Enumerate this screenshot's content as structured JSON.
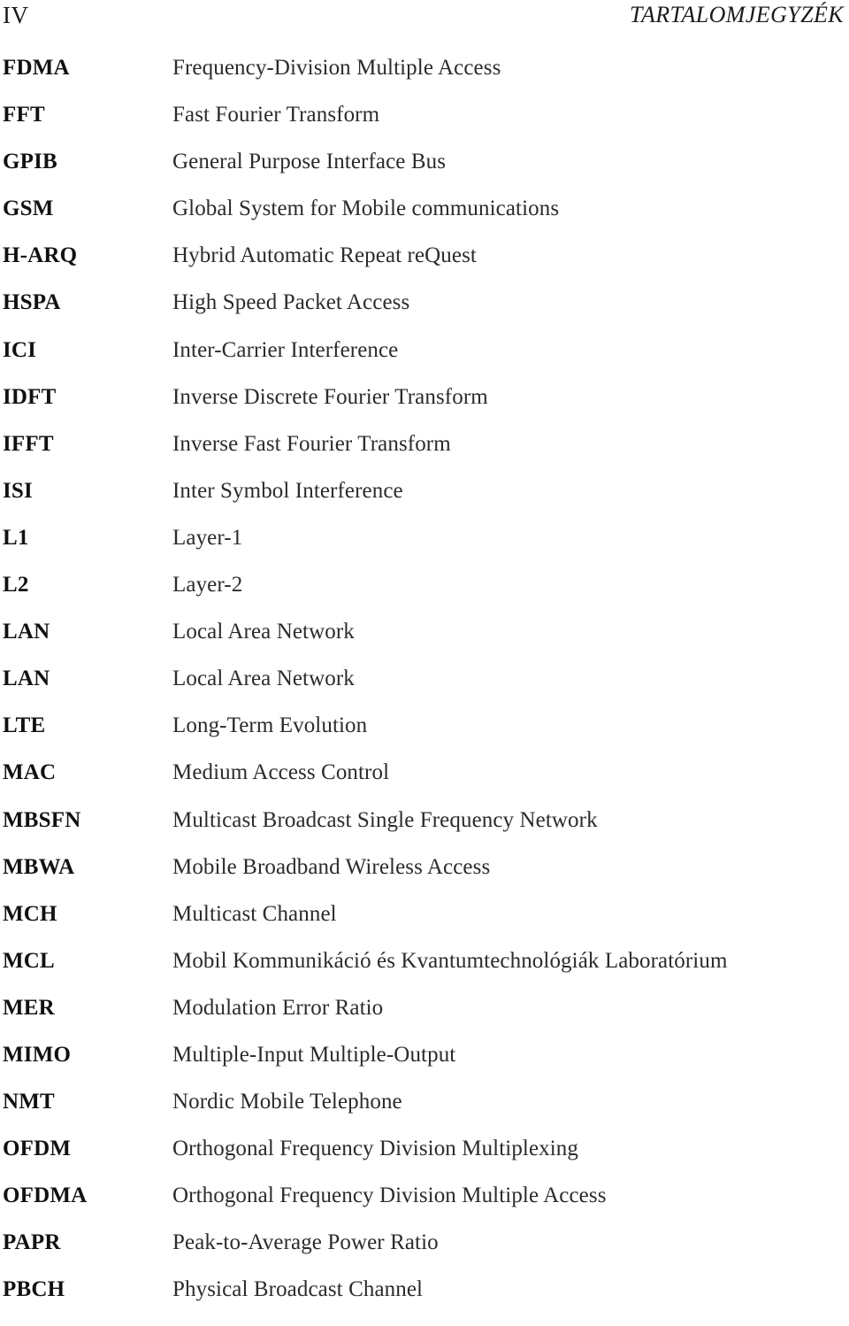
{
  "header": {
    "folio": "IV",
    "running_title": "TARTALOMJEGYZÉK"
  },
  "glossary": {
    "rows": [
      {
        "abbr": "FDMA",
        "definition": "Frequency-Division Multiple Access"
      },
      {
        "abbr": "FFT",
        "definition": "Fast Fourier Transform"
      },
      {
        "abbr": "GPIB",
        "definition": "General Purpose Interface Bus"
      },
      {
        "abbr": "GSM",
        "definition": "Global System for Mobile communications"
      },
      {
        "abbr": "H-ARQ",
        "definition": "Hybrid Automatic Repeat reQuest"
      },
      {
        "abbr": "HSPA",
        "definition": "High Speed Packet Access"
      },
      {
        "abbr": "ICI",
        "definition": "Inter-Carrier Interference"
      },
      {
        "abbr": "IDFT",
        "definition": "Inverse Discrete Fourier Transform"
      },
      {
        "abbr": "IFFT",
        "definition": "Inverse Fast Fourier Transform"
      },
      {
        "abbr": "ISI",
        "definition": "Inter Symbol Interference"
      },
      {
        "abbr": "L1",
        "definition": "Layer-1"
      },
      {
        "abbr": "L2",
        "definition": "Layer-2"
      },
      {
        "abbr": "LAN",
        "definition": "Local Area Network"
      },
      {
        "abbr": "LAN",
        "definition": "Local Area Network"
      },
      {
        "abbr": "LTE",
        "definition": "Long-Term Evolution"
      },
      {
        "abbr": "MAC",
        "definition": "Medium Access Control"
      },
      {
        "abbr": "MBSFN",
        "definition": "Multicast Broadcast Single Frequency Network"
      },
      {
        "abbr": "MBWA",
        "definition": "Mobile Broadband Wireless Access"
      },
      {
        "abbr": "MCH",
        "definition": "Multicast Channel"
      },
      {
        "abbr": "MCL",
        "definition": "Mobil Kommunikáció és Kvantumtechnológiák Laboratórium"
      },
      {
        "abbr": "MER",
        "definition": "Modulation Error Ratio"
      },
      {
        "abbr": "MIMO",
        "definition": "Multiple-Input Multiple-Output"
      },
      {
        "abbr": "NMT",
        "definition": "Nordic Mobile Telephone"
      },
      {
        "abbr": "OFDM",
        "definition": "Orthogonal Frequency Division Multiplexing"
      },
      {
        "abbr": "OFDMA",
        "definition": "Orthogonal Frequency Division Multiple Access"
      },
      {
        "abbr": "PAPR",
        "definition": "Peak-to-Average Power Ratio"
      },
      {
        "abbr": "PBCH",
        "definition": "Physical Broadcast Channel"
      }
    ]
  }
}
